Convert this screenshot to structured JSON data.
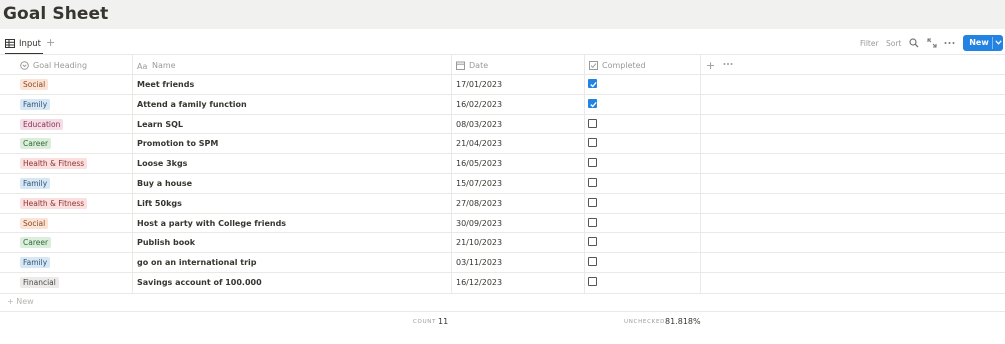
{
  "page": {
    "title": "Goal Sheet"
  },
  "view": {
    "tab_label": "Input",
    "add_view": "+"
  },
  "toolbar": {
    "filter": "Filter",
    "sort": "Sort",
    "new_label": "New"
  },
  "columns": {
    "goal_heading": "Goal Heading",
    "name": "Name",
    "date": "Date",
    "completed": "Completed",
    "add": "+"
  },
  "tag_colors": {
    "Social": {
      "bg": "#fbe3d6",
      "fg": "#8a4a24"
    },
    "Family": {
      "bg": "#d8e7f4",
      "fg": "#2c5478"
    },
    "Education": {
      "bg": "#f5dde6",
      "fg": "#8a2d52"
    },
    "Career": {
      "bg": "#dbeddb",
      "fg": "#2f6a38"
    },
    "Health & Fitness": {
      "bg": "#fbe0df",
      "fg": "#8e3331"
    },
    "Financial": {
      "bg": "#ecebea",
      "fg": "#4a4844"
    }
  },
  "rows": [
    {
      "goal": "Social",
      "name": "Meet friends",
      "date": "17/01/2023",
      "completed": true
    },
    {
      "goal": "Family",
      "name": "Attend a family function",
      "date": "16/02/2023",
      "completed": true
    },
    {
      "goal": "Education",
      "name": "Learn SQL",
      "date": "08/03/2023",
      "completed": false
    },
    {
      "goal": "Career",
      "name": "Promotion to SPM",
      "date": "21/04/2023",
      "completed": false
    },
    {
      "goal": "Health & Fitness",
      "name": "Loose 3kgs",
      "date": "16/05/2023",
      "completed": false
    },
    {
      "goal": "Family",
      "name": "Buy a house",
      "date": "15/07/2023",
      "completed": false
    },
    {
      "goal": "Health & Fitness",
      "name": "Lift 50kgs",
      "date": "27/08/2023",
      "completed": false
    },
    {
      "goal": "Social",
      "name": "Host a party with College friends",
      "date": "30/09/2023",
      "completed": false
    },
    {
      "goal": "Career",
      "name": "Publish book",
      "date": "21/10/2023",
      "completed": false
    },
    {
      "goal": "Family",
      "name": "go on an international trip",
      "date": "03/11/2023",
      "completed": false
    },
    {
      "goal": "Financial",
      "name": "Savings account of 100.000",
      "date": "16/12/2023",
      "completed": false
    }
  ],
  "add_row": "+ New",
  "footer": {
    "count_label": "COUNT",
    "count_value": "11",
    "unchecked_label": "UNCHECKED",
    "unchecked_value": "81.818%"
  }
}
